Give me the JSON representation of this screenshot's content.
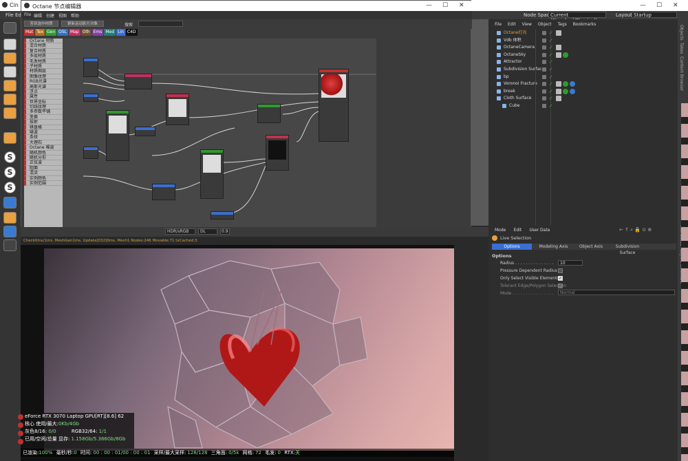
{
  "c4d": {
    "title": "Cin",
    "menu": [
      "File",
      "Ed"
    ],
    "node_space_label": "Node Space:",
    "node_space_value": "Current (Standard/Physical)",
    "layout_label": "Layout:",
    "layout_value": "Startup"
  },
  "node_editor": {
    "title": "Octane 节点编辑器",
    "menu": [
      "File",
      "编辑",
      "创建",
      "视图",
      "帮助"
    ],
    "toolbar": [
      "答到选中材质",
      "更新运动影片对象",
      "搜索"
    ],
    "tabs": [
      {
        "label": "Mat",
        "color": "#c03030"
      },
      {
        "label": "Tex",
        "color": "#b07020"
      },
      {
        "label": "Gen",
        "color": "#2f9a2f"
      },
      {
        "label": "OSL",
        "color": "#3070c0"
      },
      {
        "label": "Map",
        "color": "#c03060"
      },
      {
        "label": "Oth",
        "color": "#705030"
      },
      {
        "label": "Ems",
        "color": "#8040a0"
      },
      {
        "label": "Med",
        "color": "#207f70"
      },
      {
        "label": "Lin",
        "color": "#3a6fd0"
      },
      {
        "label": "C4D",
        "color": "#111111"
      }
    ],
    "list": [
      "Octane 材质",
      "混合材质",
      "复合材质",
      "多层材质",
      "毛发材质",
      "子材质",
      "材质图层",
      "图像纹理",
      "RGB光谱",
      "高斯光谱",
      "浮点",
      "属性",
      "世界坐标",
      "切线纹理",
      "多参数平铺",
      "变换",
      "投射",
      "棋盘格",
      "噪波",
      "条纹",
      "大理石",
      "Octane 噪波",
      "随机颜色",
      "随机分形",
      "正弦波",
      "阻面",
      "混流",
      "实例颜色",
      "实例范围"
    ]
  },
  "objects": {
    "menu": [
      "File",
      "Edit",
      "View",
      "Object",
      "Tags",
      "Bookmarks"
    ],
    "rows": [
      {
        "name": "Octane灯光",
        "color": "#e8a040",
        "indent": 0
      },
      {
        "name": "Vdb 体积",
        "color": "#dddddd",
        "indent": 0
      },
      {
        "name": "OctaneCamera",
        "color": "#dddddd",
        "indent": 0
      },
      {
        "name": "OctaneSky",
        "color": "#dddddd",
        "indent": 0
      },
      {
        "name": "Attractor",
        "color": "#dddddd",
        "indent": 0
      },
      {
        "name": "Subdivision Surface",
        "color": "#dddddd",
        "indent": 0
      },
      {
        "name": "bp",
        "color": "#dddddd",
        "indent": 0
      },
      {
        "name": "Voronoi Fracture",
        "color": "#dddddd",
        "indent": 0
      },
      {
        "name": "break",
        "color": "#dddddd",
        "indent": 0
      },
      {
        "name": "Cloth Surface",
        "color": "#dddddd",
        "indent": 0
      },
      {
        "name": "Cube",
        "color": "#dddddd",
        "indent": 1
      }
    ]
  },
  "attributes": {
    "menu": [
      "Mode",
      "Edit",
      "User Data"
    ],
    "title": "Live Selection",
    "tabs": [
      "Options",
      "Modeling Axis",
      "Object Axis",
      "Subdivision Surface"
    ],
    "section": "Options",
    "radius_label": "Radius . . . . . . . . . . . . . . .",
    "radius_value": "10",
    "pressure_label": "Pressure Dependent Radius .",
    "visible_label": "Only Select Visible Elements .",
    "tolerant_label": "Tolerant Edge/Polygon Selection",
    "mode_label": "Mode . . . . . . . . . . . . . . . .",
    "mode_value": "Normal",
    "side_tabs": [
      "Attributes",
      "Layers",
      "Structure"
    ],
    "top_side_tabs": [
      "Objects",
      "Takes",
      "Content Browser"
    ]
  },
  "render": {
    "toolbar_hdr": "HDR/sRGB",
    "toolbar_dl": "DL",
    "toolbar_val": "0.9",
    "status": "Check0ms/1ms. MeshGen1ms. Update[032]0ms. Mesh1 Nodes:246 Movable:71 txCached:3",
    "gpu_name": "eForce RTX 3070 Laptop GPU[RT][8.6]",
    "gpu_temp": "62",
    "core_label": "核心 使用/最大:",
    "core_value": "0Kb/4Gb",
    "gray_label": "灰色8/16:",
    "gray_value": "0/0",
    "rgb_label": "RGB32/64:",
    "rgb_value": "1/1",
    "mem_label": "已用/空闲/总量 显存:",
    "mem_value": "1.158Gb/5.366Gb/8Gb",
    "rendered_label": "已渲染:",
    "rendered_value": "100%",
    "ms_label": "毫秒/秒:",
    "ms_value": "0",
    "time_label": "时间:",
    "time_value": "00 : 00 : 01/00 : 00 : 01",
    "samples_label": "采样/最大采样:",
    "samples_value": "128/128",
    "tri_label": "三角面:",
    "tri_value": "0/5k",
    "mesh_label": "网格:",
    "mesh_value": "72",
    "hair_label": "毛发:",
    "hair_value": "0",
    "rtx_label": "RTX:",
    "rtx_value": "关"
  }
}
